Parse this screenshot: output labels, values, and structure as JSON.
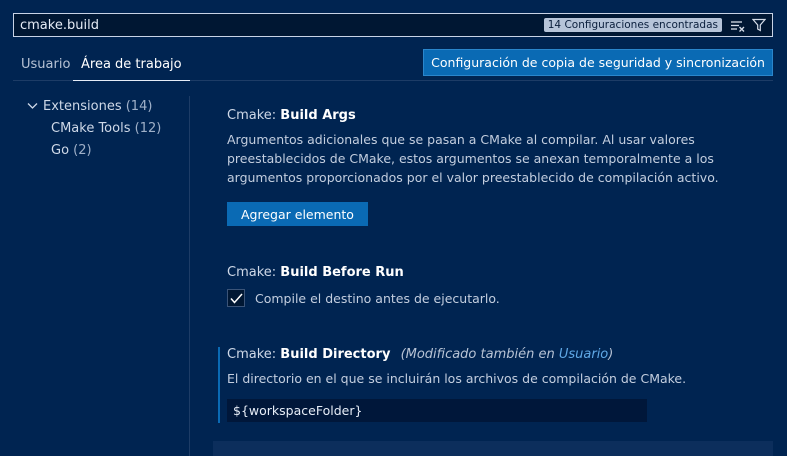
{
  "search": {
    "value": "cmake.build",
    "results_badge": "14 Configuraciones encontradas",
    "clear_filter_icon": "clear-filter-icon",
    "filter_icon": "filter-icon"
  },
  "tabs": [
    {
      "label": "Usuario"
    },
    {
      "label": "Área de trabajo"
    }
  ],
  "sync_button_label": "Configuración de copia de seguridad y sincronización",
  "toc": {
    "extensions": {
      "label": "Extensiones",
      "count": "(14)"
    },
    "cmake_tools": {
      "label": "CMake Tools",
      "count": "(12)"
    },
    "go": {
      "label": "Go",
      "count": "(2)"
    }
  },
  "settings": {
    "build_args": {
      "category": "Cmake: ",
      "key": "Build Args",
      "description": "Argumentos adicionales que se pasan a CMake al compilar. Al usar valores preestablecidos de CMake, estos argumentos se anexan temporalmente a los argumentos proporcionados por el valor preestablecido de compilación activo.",
      "button_label": "Agregar elemento"
    },
    "build_before_run": {
      "category": "Cmake: ",
      "key": "Build Before Run",
      "checkbox_label": "Compile el destino antes de ejecutarlo.",
      "checked": true
    },
    "build_directory": {
      "category": "Cmake: ",
      "key": "Build Directory",
      "modified_prefix": "(Modificado también en ",
      "modified_link": "Usuario",
      "modified_suffix": ")",
      "description": "El directorio en el que se incluirán los archivos de compilación de CMake.",
      "value": "${workspaceFolder}"
    }
  },
  "colors": {
    "background": "#002451",
    "accent": "#0a6ab4",
    "link": "#5fa8e6"
  }
}
